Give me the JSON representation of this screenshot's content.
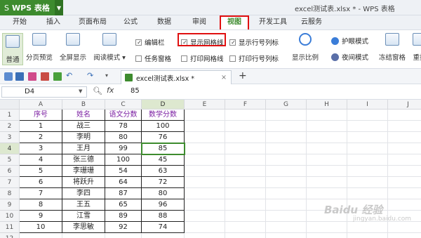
{
  "app": {
    "name": "WPS 表格",
    "document_title": "excel测试表.xlsx * - WPS 表格"
  },
  "menu": {
    "items": [
      "开始",
      "插入",
      "页面布局",
      "公式",
      "数据",
      "审阅",
      "视图",
      "开发工具",
      "云服务"
    ],
    "active": "视图"
  },
  "ribbon": {
    "big_buttons": [
      "普通",
      "分页预览",
      "全屏显示",
      "阅读模式 ▾"
    ],
    "checkboxes": [
      {
        "label": "编辑栏",
        "checked": true
      },
      {
        "label": "任务窗格",
        "checked": false
      },
      {
        "label": "显示网格线",
        "checked": true
      },
      {
        "label": "打印网格线",
        "checked": false
      },
      {
        "label": "显示行号列标",
        "checked": true
      },
      {
        "label": "打印行号列标",
        "checked": false
      }
    ],
    "zoom_label": "显示比例",
    "eye_protect": "护眼模式",
    "night_mode": "夜间模式",
    "freeze": "冻结窗格",
    "rearrange": "重排"
  },
  "quick_access": {
    "tab_label": "excel测试表.xlsx *",
    "tab_close": "×",
    "add_tab": "+"
  },
  "formula_bar": {
    "cell_ref": "D4",
    "fx": "fx",
    "value": "85"
  },
  "sheet": {
    "columns": [
      "A",
      "B",
      "C",
      "D",
      "E",
      "F",
      "G",
      "H",
      "I",
      "J"
    ],
    "rows": [
      "1",
      "2",
      "3",
      "4",
      "5",
      "6",
      "7",
      "8",
      "9",
      "10",
      "11",
      "12"
    ],
    "headers": [
      "序号",
      "姓名",
      "语文分数",
      "数学分数"
    ],
    "data": [
      [
        "1",
        "战三",
        "78",
        "100"
      ],
      [
        "2",
        "李明",
        "80",
        "76"
      ],
      [
        "3",
        "王月",
        "99",
        "85"
      ],
      [
        "4",
        "张三德",
        "100",
        "45"
      ],
      [
        "5",
        "李珊珊",
        "54",
        "63"
      ],
      [
        "6",
        "将跃升",
        "64",
        "72"
      ],
      [
        "7",
        "李四",
        "87",
        "80"
      ],
      [
        "8",
        "王五",
        "65",
        "96"
      ],
      [
        "9",
        "江雪",
        "89",
        "88"
      ],
      [
        "10",
        "李思敏",
        "92",
        "74"
      ]
    ],
    "selected_cell": "D4"
  },
  "colors": {
    "accent": "#3d8b2e",
    "highlight_box": "#e01010"
  },
  "watermark": {
    "main": "Baidu 经验",
    "sub": "jingyan.baidu.com"
  }
}
